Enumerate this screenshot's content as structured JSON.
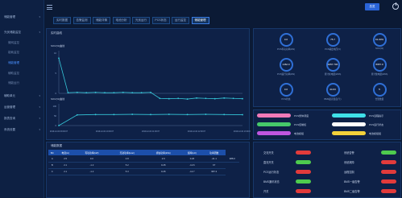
{
  "sidebar": {
    "items": [
      {
        "label": "储能管理",
        "level": "main",
        "active": false
      },
      {
        "label": "光伏储能监控",
        "level": "main",
        "active": false
      },
      {
        "label": "微网监控",
        "level": "sub",
        "active": false
      },
      {
        "label": "能耗监控",
        "level": "sub",
        "active": false
      },
      {
        "label": "储能管理",
        "level": "sub",
        "active": true
      },
      {
        "label": "辅助监控",
        "level": "sub",
        "active": false
      },
      {
        "label": "储能运行",
        "level": "sub",
        "active": false
      },
      {
        "label": "辅助单元",
        "level": "main",
        "active": false
      },
      {
        "label": "运营管理",
        "level": "main",
        "active": false
      },
      {
        "label": "报表查询",
        "level": "main",
        "active": false
      },
      {
        "label": "系统设置",
        "level": "main",
        "active": false
      }
    ]
  },
  "header": {
    "top_button": "总览"
  },
  "tabs": [
    "实时数据",
    "告警监测",
    "储能详情",
    "电池分析",
    "光伏运行",
    "PCS状态",
    "运行监控",
    "储能管理"
  ],
  "chart_panel": {
    "title": "实时曲线"
  },
  "chart_data": [
    {
      "type": "line",
      "title": "SOC(%)曲线",
      "y_ticks": [
        "10",
        "5",
        "0"
      ],
      "ylim": [
        0,
        12
      ],
      "x": [
        0,
        1,
        2,
        3,
        4,
        5,
        6,
        7,
        8,
        9,
        10,
        11,
        12,
        13,
        14,
        15,
        16,
        17,
        18,
        19,
        20
      ],
      "values": [
        10.5,
        0.2,
        0.3,
        0.2,
        0.3,
        0.2,
        0.2,
        0.3,
        0.2,
        0.2,
        0.3,
        -1.5,
        -1.6,
        -1.5,
        -1.7,
        -1.4,
        -1.5,
        -1.6,
        -1.4,
        -1.5,
        -1.6
      ]
    },
    {
      "type": "line",
      "title": "SOC(%)曲线",
      "y_ticks": [
        "100",
        "50",
        "0"
      ],
      "ylim": [
        0,
        100
      ],
      "x": [
        0,
        1,
        2,
        3,
        4,
        5,
        6,
        7,
        8,
        9,
        10
      ],
      "values": [
        0,
        55,
        57,
        57,
        58,
        57,
        58,
        57,
        58,
        57,
        56
      ],
      "x_tick_labels": [
        "2019-12-02 09:00:07",
        "2019-12-02 10:00:07",
        "2019-12-02 11:00:07",
        "2019-12-02 12:00:07",
        "2019-12-02 13:00:07"
      ]
    }
  ],
  "dials": [
    {
      "value": "0.0",
      "label": "PCS有功功率(kW)"
    },
    {
      "value": "75.7",
      "label": "PCS输出电压(V)"
    },
    {
      "value": "91.00%",
      "label": "SOC(%)"
    },
    {
      "value": "1462.0",
      "label": "PCS运行功率(kW)"
    },
    {
      "value": "9457.706",
      "label": "累计充电量(kWh)"
    },
    {
      "value": "8957.0",
      "label": "累计放电量(kWh)"
    },
    {
      "value": "0.0",
      "label": "PCS状态"
    },
    {
      "value": "44.63",
      "label": "BMS最高温度(℃)"
    },
    {
      "value": "5",
      "label": "告警数量"
    }
  ],
  "pills": [
    {
      "color": "#f07ab8",
      "label": "PCS整体调度"
    },
    {
      "color": "#3fe0e8",
      "label": "PCS远程指示"
    },
    {
      "color": "#46c96a",
      "label": "PCS控制权"
    },
    {
      "color": "#ffffff",
      "label": "PCS运行状态"
    },
    {
      "color": "#c056e0",
      "label": "电池模组"
    },
    {
      "color": "#f2d13a",
      "label": "电池模组组"
    }
  ],
  "table": {
    "title": "储能数据",
    "headers": [
      "BC",
      "电流(A)",
      "有功功率(kW)",
      "无功功率(kvar)",
      "视在功率(kVA)",
      "频率(Hz)",
      "功率因数"
    ],
    "rows": [
      [
        "A",
        "2.5",
        "0.0",
        "4.8",
        "2.6",
        "0.26",
        "-21.1",
        "988.0"
      ],
      [
        "B",
        "2.1",
        "-1.2",
        "5.2",
        "0.28",
        "-12.6",
        "97"
      ],
      [
        "C",
        "2.1",
        "-1.2",
        "5.3",
        "0.28",
        "-12.7",
        "987.3"
      ]
    ]
  },
  "status_left": [
    {
      "label": "交流开关",
      "color": "#e23b3b"
    },
    {
      "label": "直流开关",
      "color": "#4ecb4e"
    },
    {
      "label": "PCS运行状态",
      "color": "#e23b3b"
    },
    {
      "label": "BMS通讯状态",
      "color": "#4ecb4e"
    },
    {
      "label": "开关",
      "color": "#e23b3b"
    }
  ],
  "status_right": [
    {
      "label": "系统告警",
      "color": "#4ecb4e"
    },
    {
      "label": "系统故障",
      "color": "#e23b3b"
    },
    {
      "label": "远程控制",
      "color": "#e23b3b"
    },
    {
      "label": "BMS一级告警",
      "color": "#e23b3b"
    },
    {
      "label": "BMS二级告警",
      "color": "#e23b3b"
    }
  ]
}
